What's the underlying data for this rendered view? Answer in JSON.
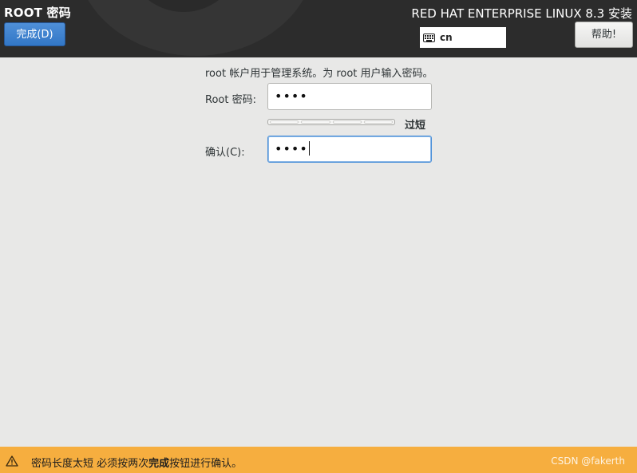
{
  "header": {
    "page_title": "ROOT 密码",
    "done_button": "完成(D)",
    "product_title": "RED HAT ENTERPRISE LINUX 8.3 安装",
    "keyboard_layout": "cn",
    "help_button": "帮助!"
  },
  "form": {
    "description": "root 帐户用于管理系统。为 root 用户输入密码。",
    "root_password_label": "Root 密码:",
    "root_password_mask": "••••",
    "strength_label": "过短",
    "strength_fraction": 0,
    "confirm_label": "确认(C):",
    "confirm_password_mask": "••••"
  },
  "warning": {
    "text_before": "密码长度太短 必须按两次",
    "text_bold": "完成",
    "text_after": "按钮进行确认。"
  },
  "watermark": "CSDN @fakerth",
  "colors": {
    "header_bg": "#2c2c2c",
    "accent_blue": "#3a80cf",
    "warning_bar": "#f6ae3f",
    "page_bg": "#e8e8e7"
  }
}
